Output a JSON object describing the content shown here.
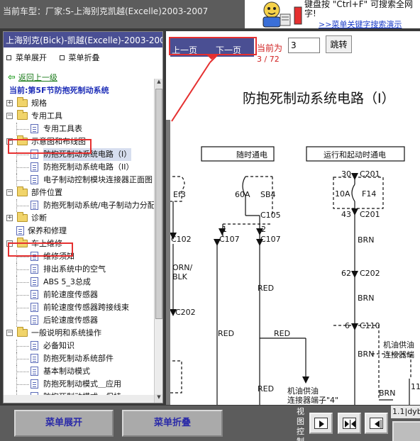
{
  "header": {
    "vehicle_text": "当前车型：厂家:S-上海别克凯越(Excelle)2003-2007",
    "promo_line1": "键盘按 \"Ctrl+F\" 可搜索全网",
    "promo_line2": "字!",
    "promo_link": ">>菜单关键字搜索演示"
  },
  "left_panel": {
    "title": "上海别克(Bick)-凯越(Excelle)-2003-2006",
    "expand_label": "菜单展开",
    "collapse_label": "菜单折叠",
    "back_label": "返回上一级",
    "current_label": "当前:第5F节防抱死制动系统",
    "tree": [
      {
        "label": "规格",
        "type": "folder",
        "level": 0,
        "expanded": false
      },
      {
        "label": "专用工具",
        "type": "folder",
        "level": 0,
        "expanded": true
      },
      {
        "label": "专用工具表",
        "type": "doc",
        "level": 1
      },
      {
        "label": "示意图和布线图",
        "type": "folder",
        "level": 0,
        "expanded": true,
        "highlighted": true
      },
      {
        "label": "防抱死制动系统电路（I）",
        "type": "doc",
        "level": 1,
        "selected": true
      },
      {
        "label": "防抱死制动系统电路（II）",
        "type": "doc",
        "level": 1
      },
      {
        "label": "电子制动控制模块连接器正面图",
        "type": "doc",
        "level": 1
      },
      {
        "label": "部件位置",
        "type": "folder",
        "level": 0,
        "expanded": true
      },
      {
        "label": "防抱死制动系统/电子制动力分配",
        "type": "doc",
        "level": 1
      },
      {
        "label": "诊断",
        "type": "folder",
        "level": 0,
        "expanded": false
      },
      {
        "label": "保养和修理",
        "type": "doc",
        "level": 0
      },
      {
        "label": "车上维修",
        "type": "folder",
        "level": 0,
        "expanded": true,
        "highlighted": true
      },
      {
        "label": "维修须知",
        "type": "doc",
        "level": 1
      },
      {
        "label": "排出系统中的空气",
        "type": "doc",
        "level": 1
      },
      {
        "label": "ABS 5_3总成",
        "type": "doc",
        "level": 1
      },
      {
        "label": "前轮速度传感器",
        "type": "doc",
        "level": 1
      },
      {
        "label": "前轮速度传感器跨接线束",
        "type": "doc",
        "level": 1
      },
      {
        "label": "后轮速度传感器",
        "type": "doc",
        "level": 1
      },
      {
        "label": "一般说明和系统操作",
        "type": "folder",
        "level": 0,
        "expanded": true
      },
      {
        "label": "必备知识",
        "type": "doc",
        "level": 1
      },
      {
        "label": "防抱死制动系统部件",
        "type": "doc",
        "level": 1
      },
      {
        "label": "基本制动模式",
        "type": "doc",
        "level": 1
      },
      {
        "label": "防抱死制动模式＿应用",
        "type": "doc",
        "level": 1
      },
      {
        "label": "防抱死制动模式＿保持",
        "type": "doc",
        "level": 1
      }
    ]
  },
  "viewer": {
    "prev_label": "上一页",
    "next_label": "下一页",
    "page_label": "当前为",
    "page_value": "3",
    "jump_label": "跳转",
    "page_count": "3 / 72",
    "diagram": {
      "title": "防抱死制动系统电路（I）",
      "box_left": "随时通电",
      "box_right": "运行和起动时通电",
      "labels": [
        "Ef3",
        "60A",
        "SB4",
        "C105",
        "C102",
        "C107",
        "C107",
        "1",
        "2",
        "ORN/",
        "BLK",
        "RED",
        "C202",
        "RED",
        "RED",
        "RED",
        "30",
        "C201",
        "10A",
        "F14",
        "43",
        "C201",
        "BRN",
        "62",
        "C202",
        "BRN",
        "6",
        "C110",
        "BRN",
        "BRN",
        "机油供油",
        "连接器端子\"4\"",
        "机油供油",
        "连接器端",
        "11"
      ]
    }
  },
  "bottom": {
    "expand_label": "菜单展开",
    "collapse_label": "菜单折叠",
    "view_ctrl_label": "视图控制",
    "zoom_text": "1.1|dyb"
  },
  "icons": {
    "back": "green-arrow-left-icon",
    "folder": "folder-icon",
    "doc": "document-icon",
    "mascot": "mascot-icon"
  }
}
